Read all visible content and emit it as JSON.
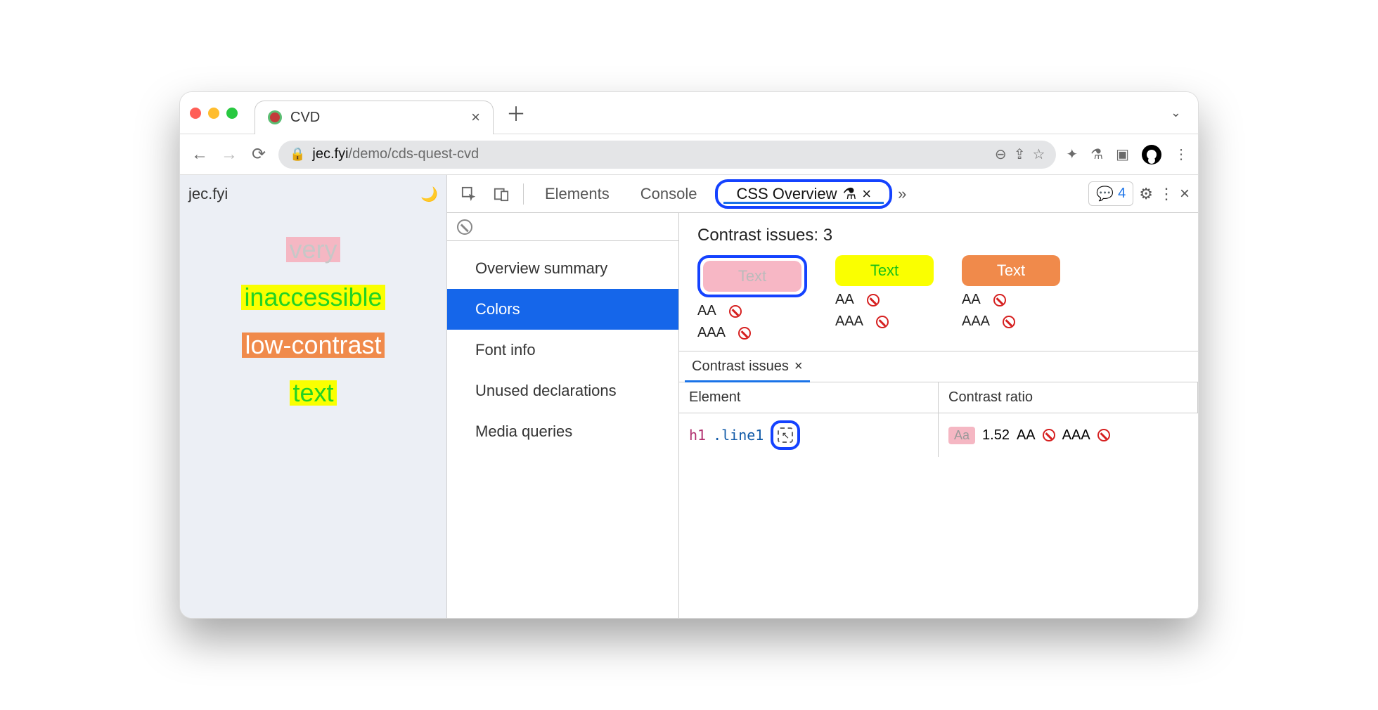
{
  "browser": {
    "tab_title": "CVD",
    "url_domain": "jec.fyi",
    "url_path": "/demo/cds-quest-cvd"
  },
  "page": {
    "site_name": "jec.fyi",
    "words": [
      "very",
      "inaccessible",
      "low-contrast",
      "text"
    ]
  },
  "devtools": {
    "tabs": [
      "Elements",
      "Console",
      "CSS Overview"
    ],
    "active_tab": "CSS Overview",
    "issues_count": "4",
    "sidebar": {
      "items": [
        "Overview summary",
        "Colors",
        "Font info",
        "Unused declarations",
        "Media queries"
      ],
      "selected": "Colors"
    },
    "contrast": {
      "title": "Contrast issues: 3",
      "swatches": [
        {
          "label": "Text",
          "aa": "AA",
          "aaa": "AAA"
        },
        {
          "label": "Text",
          "aa": "AA",
          "aaa": "AAA"
        },
        {
          "label": "Text",
          "aa": "AA",
          "aaa": "AAA"
        }
      ]
    },
    "drawer": {
      "tab": "Contrast issues",
      "columns": [
        "Element",
        "Contrast ratio"
      ],
      "row": {
        "tag": "h1",
        "class": ".line1",
        "aa_chip": "Aa",
        "ratio": "1.52",
        "aa": "AA",
        "aaa": "AAA"
      }
    }
  }
}
